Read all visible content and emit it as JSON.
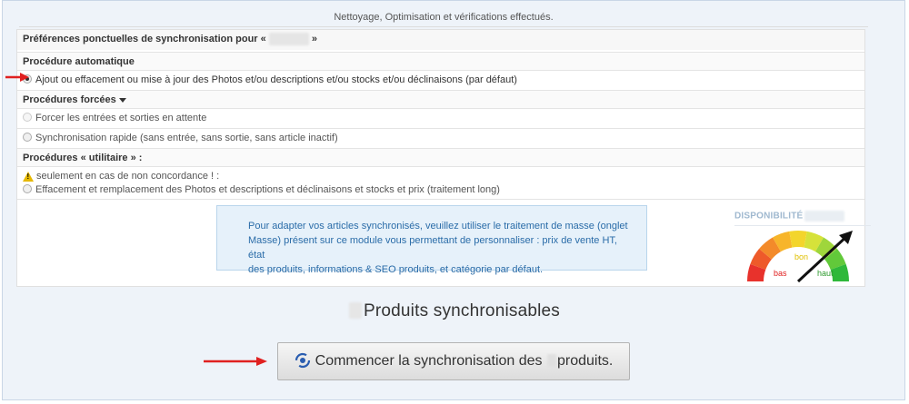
{
  "status": "Nettoyage, Optimisation et vérifications effectués.",
  "prefs": {
    "title_prefix": "Préférences ponctuelles de synchronisation pour «",
    "title_suffix": "»"
  },
  "auto": {
    "heading": "Procédure automatique",
    "option": "Ajout ou effacement ou mise à jour des Photos et/ou descriptions et/ou stocks et/ou déclinaisons (par défaut)"
  },
  "forced": {
    "heading": "Procédures forcées",
    "option1": "Forcer les entrées et sorties en attente",
    "option2": "Synchronisation rapide (sans entrée, sans sortie, sans article inactif)"
  },
  "utility": {
    "heading": "Procédures « utilitaire » :",
    "warning": "seulement en cas de non concordance ! :",
    "option": "Effacement et remplacement des Photos et descriptions et déclinaisons et stocks et prix (traitement long)"
  },
  "info": {
    "line1": "Pour adapter vos articles synchronisés, veuillez utiliser le traitement de masse (onglet",
    "line2": "Masse) présent sur ce module vous permettant de personnaliser : prix de vente HT, état",
    "line3": "des produits, informations & SEO produits, et catégorie par défaut."
  },
  "availability": {
    "label": "DISPONIBILITÉ",
    "low": "bas",
    "good": "bon",
    "high": "haut",
    "level": 0.85
  },
  "sync": {
    "title": "Produits synchronisables",
    "button_prefix": "Commencer la synchronisation des",
    "button_suffix": "produits."
  },
  "colors": {
    "panel_bg": "#eef3f9",
    "info_text": "#2a6ca8",
    "arrow_red": "#e02020"
  },
  "icons": {
    "warning": "warning-icon",
    "sync": "sync-icon",
    "caret": "caret-down-icon"
  }
}
